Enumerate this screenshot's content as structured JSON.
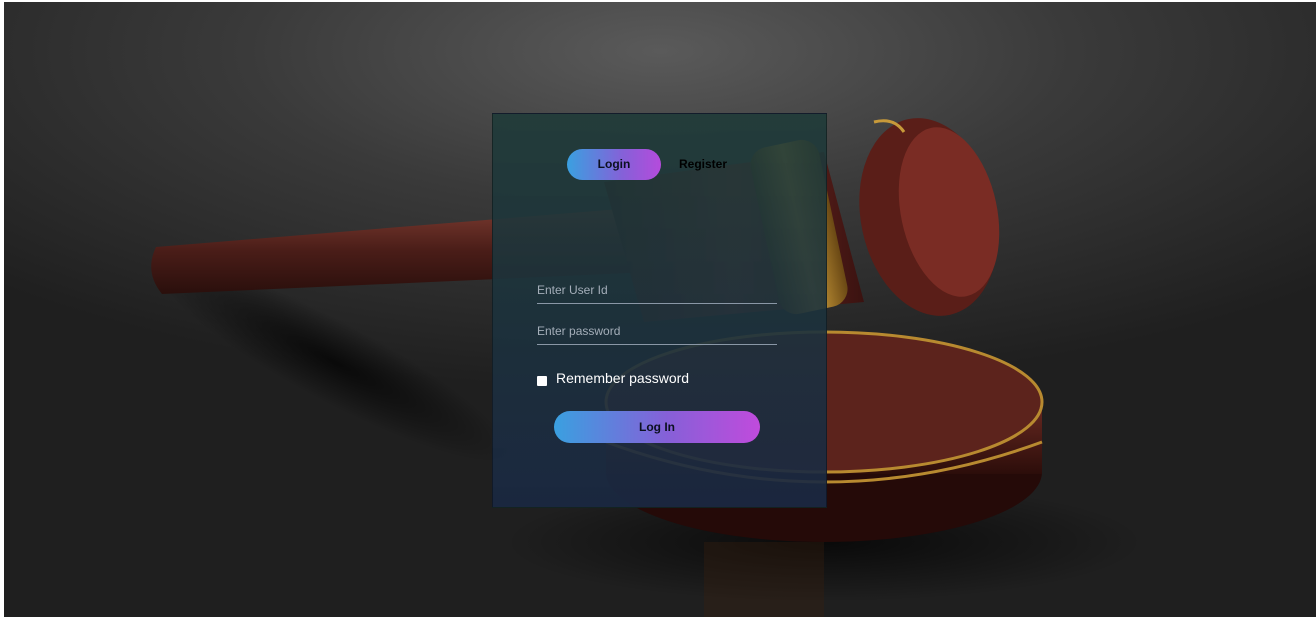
{
  "tabs": {
    "login_label": "Login",
    "register_label": "Register"
  },
  "form": {
    "user_id_placeholder": "Enter User Id",
    "user_id_value": "",
    "password_placeholder": "Enter password",
    "password_value": "",
    "remember_label": "Remember password",
    "remember_checked": false,
    "submit_label": "Log In"
  },
  "background": {
    "subject": "gavel",
    "base_color": "#2e2e2e"
  },
  "colors": {
    "gradient_start": "#3aa0e0",
    "gradient_end": "#c04bdc",
    "panel": "#1e3a38"
  }
}
